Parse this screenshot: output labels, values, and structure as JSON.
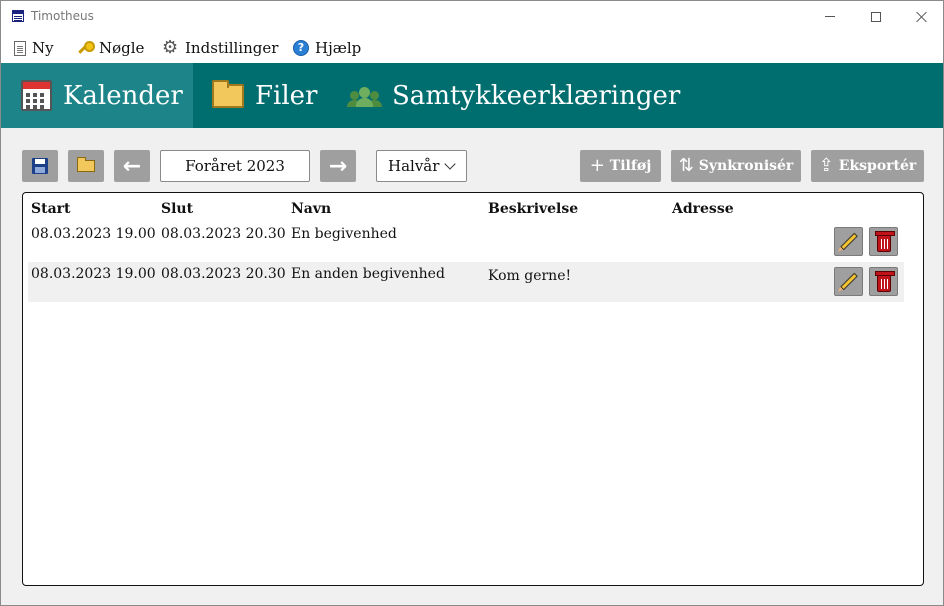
{
  "window": {
    "title": "Timotheus"
  },
  "menu": {
    "items": [
      {
        "label": "Ny",
        "icon": "new-document-icon"
      },
      {
        "label": "Nøgle",
        "icon": "key-icon"
      },
      {
        "label": "Indstillinger",
        "icon": "gear-icon"
      },
      {
        "label": "Hjælp",
        "icon": "help-icon"
      }
    ]
  },
  "tabs": [
    {
      "label": "Kalender",
      "icon": "calendar-icon",
      "active": true
    },
    {
      "label": "Filer",
      "icon": "folder-icon",
      "active": false
    },
    {
      "label": "Samtykkeerklæringer",
      "icon": "people-icon",
      "active": false
    }
  ],
  "toolbar": {
    "date_range": "Foråret 2023",
    "period": "Halvår",
    "add_label": "Tilføj",
    "sync_label": "Synkronisér",
    "export_label": "Eksportér"
  },
  "table": {
    "columns": [
      "Start",
      "Slut",
      "Navn",
      "Beskrivelse",
      "Adresse"
    ],
    "rows": [
      {
        "start": "08.03.2023 19.00",
        "slut": "08.03.2023 20.30",
        "navn": "En begivenhed",
        "beskrivelse": "",
        "adresse": ""
      },
      {
        "start": "08.03.2023 19.00",
        "slut": "08.03.2023 20.30",
        "navn": "En anden begivenhed",
        "beskrivelse": "Kom gerne!",
        "adresse": ""
      }
    ]
  },
  "colors": {
    "tab_bar": "#006d6f",
    "tab_active": "#1d8589",
    "button_gray": "#9f9f9f"
  }
}
